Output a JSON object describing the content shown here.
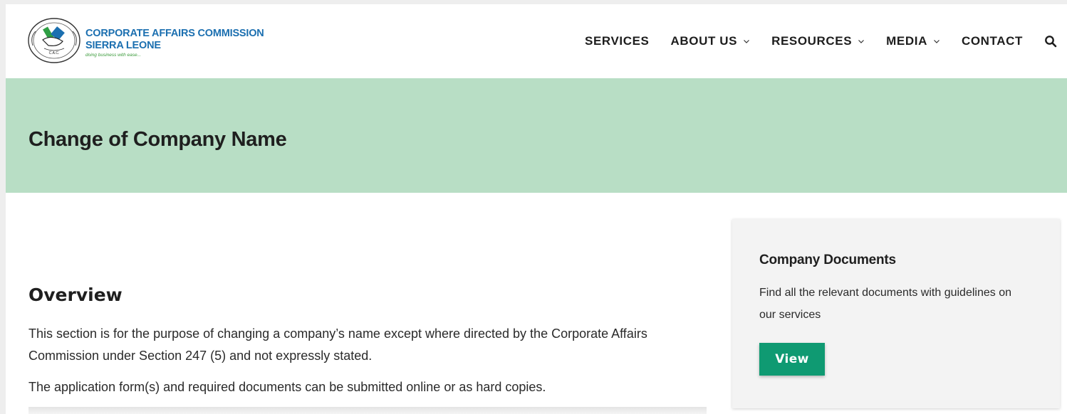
{
  "brand": {
    "line1": "CORPORATE AFFAIRS COMMISSION",
    "line2": "SIERRA LEONE",
    "tagline": "doing business with ease...",
    "seal_text": "C.A.C.",
    "primary_color": "#1b6fb0",
    "tagline_color": "#3a9a3a"
  },
  "nav": {
    "items": [
      {
        "label": "SERVICES",
        "has_dropdown": false
      },
      {
        "label": "ABOUT US",
        "has_dropdown": true
      },
      {
        "label": "RESOURCES",
        "has_dropdown": true
      },
      {
        "label": "MEDIA",
        "has_dropdown": true
      },
      {
        "label": "CONTACT",
        "has_dropdown": false
      }
    ],
    "search_icon": "search-icon"
  },
  "banner": {
    "title": "Change of Company Name",
    "background_color": "#b8dec5"
  },
  "content": {
    "heading": "Overview",
    "paragraphs": [
      "This section is for the purpose of changing a company’s name except where directed by the Corporate Affairs Commission under Section 247 (5) and not expressly stated.",
      "The application form(s) and required documents can be submitted online or as hard copies."
    ]
  },
  "sidebar": {
    "card_title": "Company Documents",
    "card_text": "Find all the relevant documents with guidelines on our services",
    "button_label": "View",
    "button_color": "#0f9a72"
  }
}
